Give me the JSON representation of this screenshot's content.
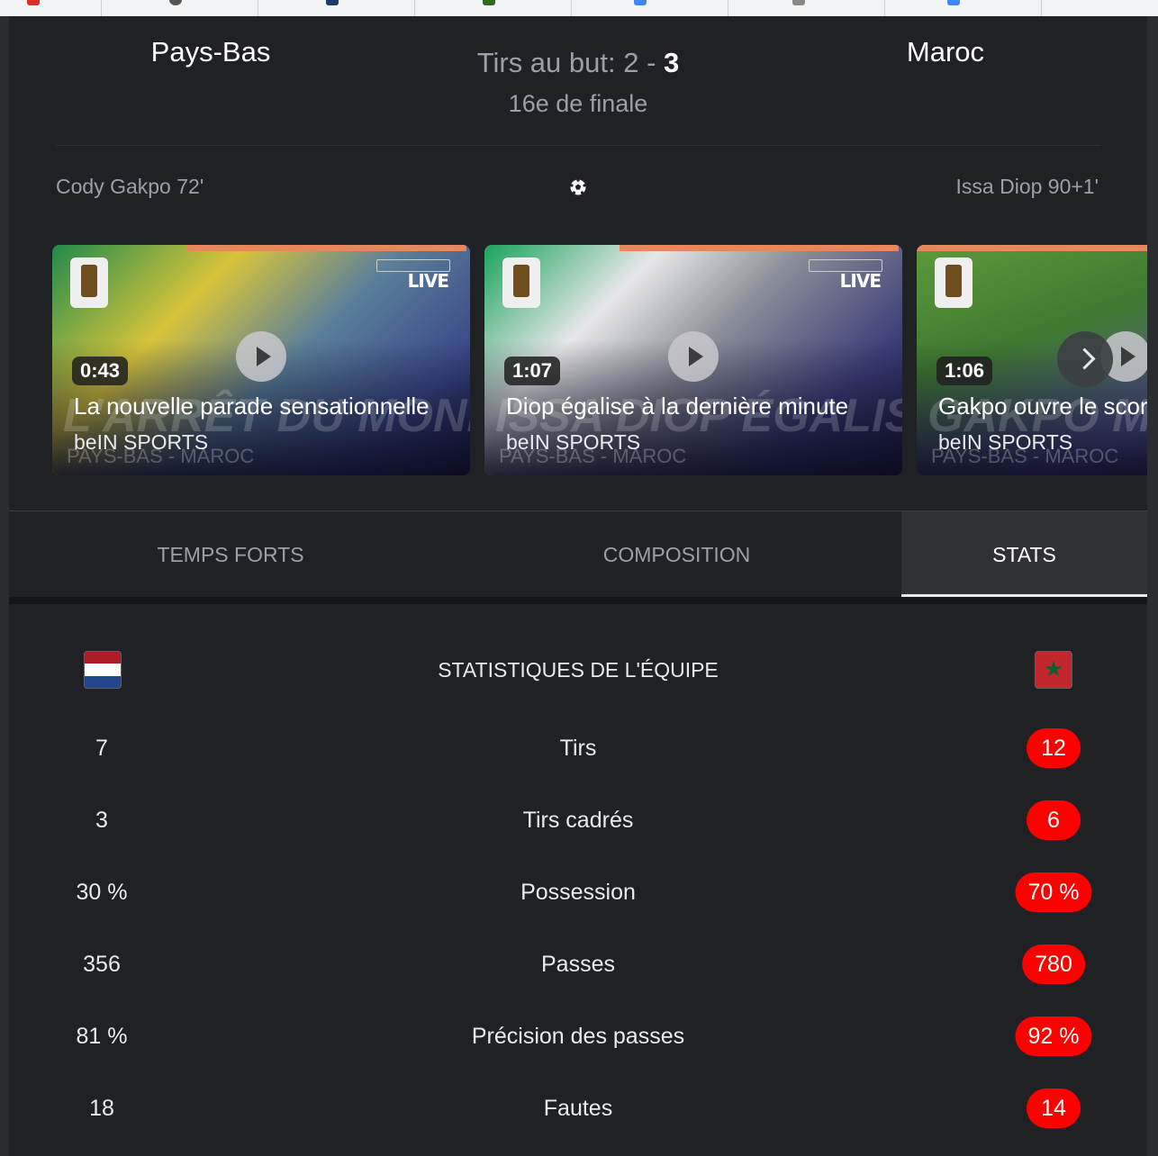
{
  "match": {
    "home_team": "Pays-Bas",
    "away_team": "Maroc",
    "score_prefix": "Tirs au but: 2",
    "score_sep": " - ",
    "score_away": "3",
    "stage": "16e de finale",
    "home_scorer": "Cody Gakpo 72'",
    "away_scorer": "Issa Diop 90+1'",
    "scorer_icon": "soccer-ball-icon"
  },
  "videos": [
    {
      "duration": "0:43",
      "title": "La nouvelle parade sensationnelle",
      "source": "beIN SPORTS",
      "overlay_text": "L'ARRÊT DU MONDIAL !",
      "overlay_sub": "PAYS-BAS - MAROC",
      "badge": "LIVE"
    },
    {
      "duration": "1:07",
      "title": "Diop égalise à la dernière minute",
      "source": "beIN SPORTS",
      "overlay_text": "ISSA DIOP ÉGALISE !",
      "overlay_sub": "PAYS-BAS - MAROC",
      "badge": "LIVE"
    },
    {
      "duration": "1:06",
      "title": "Gakpo ouvre le score",
      "source": "beIN SPORTS",
      "overlay_text": "GAKPO MARQUE ET F",
      "overlay_sub": "PAYS-BAS - MAROC",
      "badge": ""
    }
  ],
  "tabs": [
    {
      "label": "TEMPS FORTS",
      "selected": false
    },
    {
      "label": "COMPOSITION",
      "selected": false
    },
    {
      "label": "STATS",
      "selected": true
    }
  ],
  "team_stats": {
    "heading": "STATISTIQUES DE L'ÉQUIPE",
    "home_flag": "netherlands-flag-icon",
    "away_flag": "morocco-flag-icon",
    "rows": [
      {
        "label": "Tirs",
        "home": "7",
        "away": "12"
      },
      {
        "label": "Tirs cadrés",
        "home": "3",
        "away": "6"
      },
      {
        "label": "Possession",
        "home": "30 %",
        "away": "70 %"
      },
      {
        "label": "Passes",
        "home": "356",
        "away": "780"
      },
      {
        "label": "Précision des passes",
        "home": "81 %",
        "away": "92 %"
      },
      {
        "label": "Fautes",
        "home": "18",
        "away": "14"
      }
    ]
  },
  "colors": {
    "background": "#202124",
    "highlight": "#ff0000",
    "selected_tab": "#303134"
  }
}
